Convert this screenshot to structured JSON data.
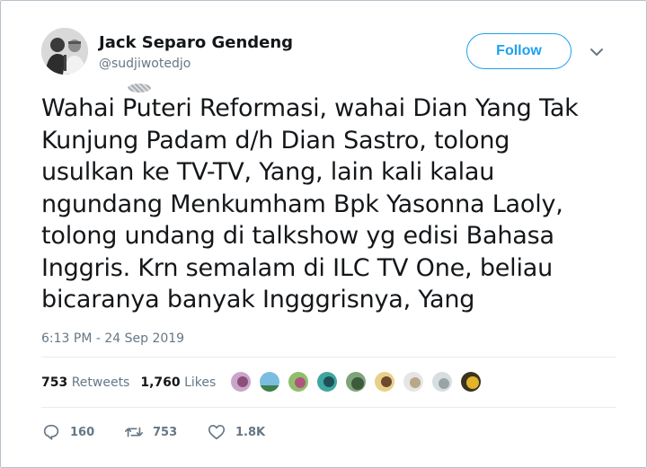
{
  "author": {
    "name": "Jack Separo Gendeng",
    "handle": "@sudjiwotedjo"
  },
  "follow_label": "Follow",
  "tweet_text": "Wahai Puteri Reformasi, wahai Dian Yang Tak\nKunjung Padam d/h Dian Sastro, tolong\nusulkan ke TV-TV, Yang, lain kali kalau\nngundang Menkumham Bpk Yasonna Laoly,\ntolong undang di talkshow yg edisi Bahasa\nInggris. Krn semalam di ILC TV One, beliau\nbicaranya banyak Ingggrisnya, Yang",
  "timestamp": "6:13 PM - 24 Sep 2019",
  "stats": {
    "retweets_count": "753",
    "retweets_label": "Retweets",
    "likes_count": "1,760",
    "likes_label": "Likes"
  },
  "actions": {
    "replies": "160",
    "retweets": "753",
    "likes": "1.8K"
  },
  "colors": {
    "accent": "#1da1f2",
    "muted": "#657786",
    "text": "#14171a"
  },
  "icons": [
    "reply-icon",
    "retweet-icon",
    "like-icon",
    "chevron-down-icon"
  ]
}
